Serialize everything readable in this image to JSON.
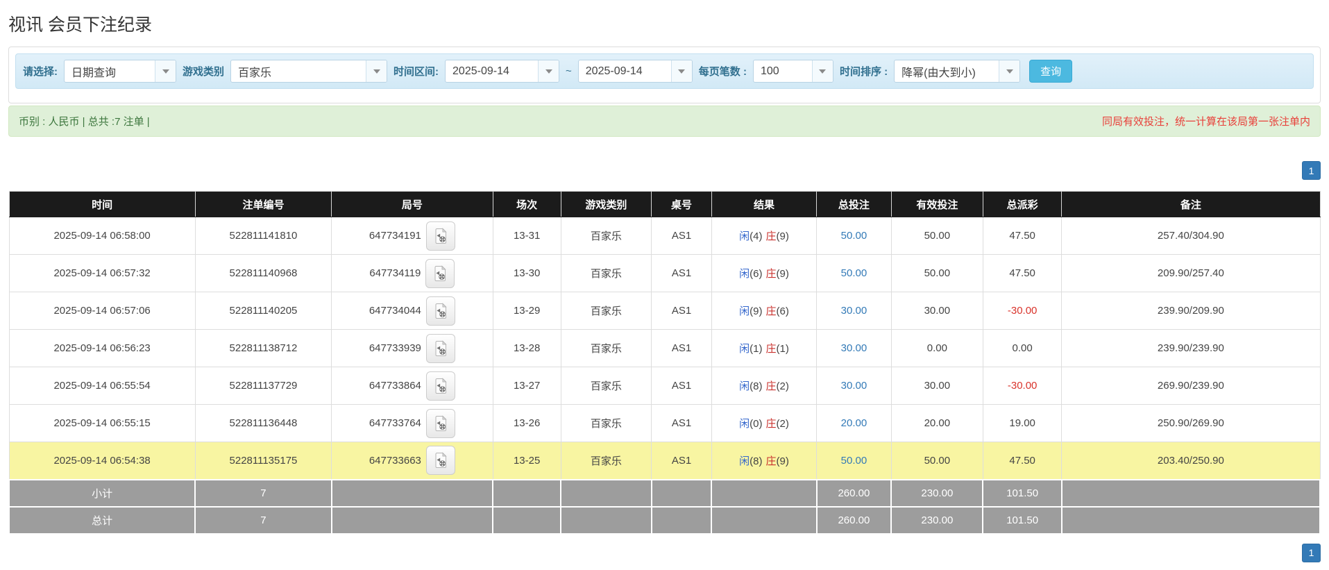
{
  "page": {
    "title": "视讯 会员下注纪录"
  },
  "filters": {
    "select_label": "请选择:",
    "select_value": "日期查询",
    "game_label": "游戏类别",
    "game_value": "百家乐",
    "range_label": "时间区间:",
    "date_from": "2025-09-14",
    "tilde": "~",
    "date_to": "2025-09-14",
    "per_page_label": "每页笔数 :",
    "per_page_value": "100",
    "sort_label": "时间排序 :",
    "sort_value": "降幂(由大到小)",
    "search_button": "查询"
  },
  "summary": {
    "left": "币别 : 人民币 | 总共 :7 注单 |",
    "right": "同局有效投注，统一计算在该局第一张注单内"
  },
  "pagination": {
    "page": "1"
  },
  "colors": {
    "accent_blue": "#337ab7",
    "toolbar_bg": "#d9edf7",
    "summary_bg": "#dff0d8",
    "summary_text": "#3c763d",
    "warning_red": "#e8403a",
    "header_bg": "#1b1b1b",
    "highlight_yellow": "#f8f5a2",
    "footer_grey": "#9d9d9d",
    "search_button_bg": "#4cb9e0",
    "player_blue": "#3366cc",
    "banker_red": "#c9302c",
    "negative_red": "#d9332b"
  },
  "table": {
    "headers": [
      "时间",
      "注单编号",
      "局号",
      "场次",
      "游戏类别",
      "桌号",
      "结果",
      "总投注",
      "有效投注",
      "总派彩",
      "备注"
    ],
    "rows": [
      {
        "time": "2025-09-14 06:58:00",
        "bet_id": "522811141810",
        "round": "647734191",
        "session": "13-31",
        "game": "百家乐",
        "table_no": "AS1",
        "result_player": "闲",
        "result_player_score": "(4)",
        "result_banker": "庄",
        "result_banker_score": "(9)",
        "total_bet": "50.00",
        "valid_bet": "50.00",
        "payout": "47.50",
        "note": "257.40/304.90",
        "highlight": false
      },
      {
        "time": "2025-09-14 06:57:32",
        "bet_id": "522811140968",
        "round": "647734119",
        "session": "13-30",
        "game": "百家乐",
        "table_no": "AS1",
        "result_player": "闲",
        "result_player_score": "(6)",
        "result_banker": "庄",
        "result_banker_score": "(9)",
        "total_bet": "50.00",
        "valid_bet": "50.00",
        "payout": "47.50",
        "note": "209.90/257.40",
        "highlight": false
      },
      {
        "time": "2025-09-14 06:57:06",
        "bet_id": "522811140205",
        "round": "647734044",
        "session": "13-29",
        "game": "百家乐",
        "table_no": "AS1",
        "result_player": "闲",
        "result_player_score": "(9)",
        "result_banker": "庄",
        "result_banker_score": "(6)",
        "total_bet": "30.00",
        "valid_bet": "30.00",
        "payout": "-30.00",
        "note": "239.90/209.90",
        "highlight": false
      },
      {
        "time": "2025-09-14 06:56:23",
        "bet_id": "522811138712",
        "round": "647733939",
        "session": "13-28",
        "game": "百家乐",
        "table_no": "AS1",
        "result_player": "闲",
        "result_player_score": "(1)",
        "result_banker": "庄",
        "result_banker_score": "(1)",
        "total_bet": "30.00",
        "valid_bet": "0.00",
        "payout": "0.00",
        "note": "239.90/239.90",
        "highlight": false
      },
      {
        "time": "2025-09-14 06:55:54",
        "bet_id": "522811137729",
        "round": "647733864",
        "session": "13-27",
        "game": "百家乐",
        "table_no": "AS1",
        "result_player": "闲",
        "result_player_score": "(8)",
        "result_banker": "庄",
        "result_banker_score": "(2)",
        "total_bet": "30.00",
        "valid_bet": "30.00",
        "payout": "-30.00",
        "note": "269.90/239.90",
        "highlight": false
      },
      {
        "time": "2025-09-14 06:55:15",
        "bet_id": "522811136448",
        "round": "647733764",
        "session": "13-26",
        "game": "百家乐",
        "table_no": "AS1",
        "result_player": "闲",
        "result_player_score": "(0)",
        "result_banker": "庄",
        "result_banker_score": "(2)",
        "total_bet": "20.00",
        "valid_bet": "20.00",
        "payout": "19.00",
        "note": "250.90/269.90",
        "highlight": false
      },
      {
        "time": "2025-09-14 06:54:38",
        "bet_id": "522811135175",
        "round": "647733663",
        "session": "13-25",
        "game": "百家乐",
        "table_no": "AS1",
        "result_player": "闲",
        "result_player_score": "(8)",
        "result_banker": "庄",
        "result_banker_score": "(9)",
        "total_bet": "50.00",
        "valid_bet": "50.00",
        "payout": "47.50",
        "note": "203.40/250.90",
        "highlight": true
      }
    ],
    "footer": [
      {
        "label": "小计",
        "count": "7",
        "total_bet": "260.00",
        "valid_bet": "230.00",
        "payout": "101.50"
      },
      {
        "label": "总计",
        "count": "7",
        "total_bet": "260.00",
        "valid_bet": "230.00",
        "payout": "101.50"
      }
    ]
  }
}
